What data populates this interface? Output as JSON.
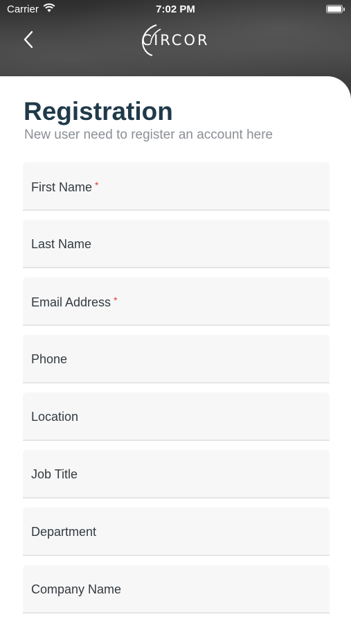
{
  "status_bar": {
    "carrier": "Carrier",
    "time": "7:02 PM"
  },
  "header": {
    "logo": "CIRCOR"
  },
  "form": {
    "title": "Registration",
    "subtitle": "New user need to register an account here",
    "required_marker": "*",
    "fields": [
      {
        "label": "First Name",
        "required": true
      },
      {
        "label": "Last Name",
        "required": false
      },
      {
        "label": "Email Address",
        "required": true
      },
      {
        "label": "Phone",
        "required": false
      },
      {
        "label": "Location",
        "required": false
      },
      {
        "label": "Job Title",
        "required": false
      },
      {
        "label": "Department",
        "required": false
      },
      {
        "label": "Company Name",
        "required": false
      }
    ]
  },
  "colors": {
    "title": "#1f3a4a",
    "required": "#e03a3a",
    "field_bg": "#f7f7f7"
  }
}
